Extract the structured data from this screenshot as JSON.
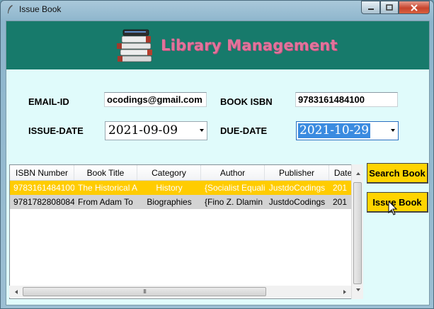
{
  "window": {
    "title": "Issue Book",
    "minimize_label": "—",
    "maximize_label": "☐",
    "close_label": "✕"
  },
  "banner": {
    "title": "Library Management",
    "bg_color": "#177a6b",
    "title_color": "#e2739b"
  },
  "form": {
    "email_label": "EMAIL-ID",
    "email_value": "ocodings@gmail.com",
    "isbn_label": "BOOK ISBN",
    "isbn_value": "9783161484100",
    "issue_date_label": "ISSUE-DATE",
    "issue_date_value": "2021-09-09",
    "due_date_label": "DUE-DATE",
    "due_date_value": "2021-10-29"
  },
  "table": {
    "columns": [
      "ISBN Number",
      "Book Title",
      "Category",
      "Author",
      "Publisher",
      "Date"
    ],
    "rows": [
      {
        "cells": [
          "9783161484100",
          "The Historical A",
          "History",
          "{Socialist Equali",
          "JustdoCodings",
          "201"
        ],
        "selected": true
      },
      {
        "cells": [
          "9781782808084",
          "From Adam To",
          "Biographies",
          "{Fino Z. Dlamin",
          "JustdoCodings",
          "201"
        ],
        "selected": false
      }
    ],
    "selected_color": "#ffcc00",
    "row_color": "#d3d3d3",
    "hscroll_grip": "III"
  },
  "buttons": {
    "search_label": "Search Book",
    "issue_label": "Issue Book",
    "color": "#ffd400"
  }
}
